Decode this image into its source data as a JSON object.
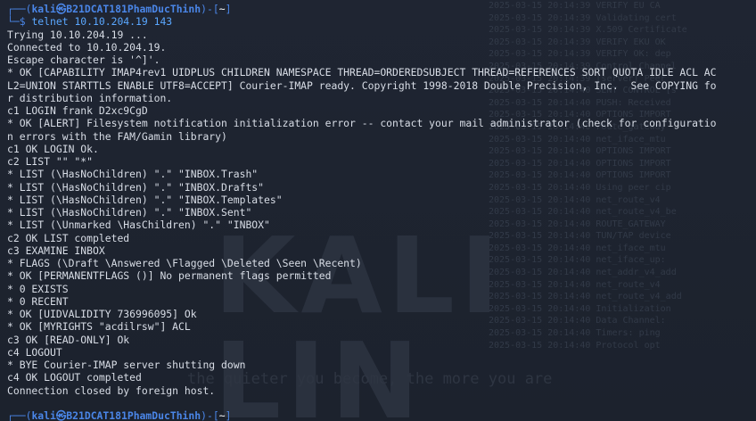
{
  "prompt": {
    "open": "┌──(",
    "user": "kali㉿B21DCAT181PhamDucThinh",
    "close": ")-[",
    "path": "~",
    "end": "]",
    "arrow": "└─$",
    "command": "telnet 10.10.204.19 143"
  },
  "output_lines": [
    "Trying 10.10.204.19 ...",
    "Connected to 10.10.204.19.",
    "Escape character is '^]'.",
    "* OK [CAPABILITY IMAP4rev1 UIDPLUS CHILDREN NAMESPACE THREAD=ORDEREDSUBJECT THREAD=REFERENCES SORT QUOTA IDLE ACL AC",
    "L2=UNION STARTTLS ENABLE UTF8=ACCEPT] Courier-IMAP ready. Copyright 1998-2018 Double Precision, Inc.  See COPYING fo",
    "r distribution information.",
    "c1 LOGIN frank D2xc9CgD",
    "* OK [ALERT] Filesystem notification initialization error -- contact your mail administrator (check for configuratio",
    "n errors with the FAM/Gamin library)",
    "c1 OK LOGIN Ok.",
    "c2 LIST \"\" \"*\"",
    "* LIST (\\HasNoChildren) \".\" \"INBOX.Trash\"",
    "* LIST (\\HasNoChildren) \".\" \"INBOX.Drafts\"",
    "* LIST (\\HasNoChildren) \".\" \"INBOX.Templates\"",
    "* LIST (\\HasNoChildren) \".\" \"INBOX.Sent\"",
    "* LIST (\\Unmarked \\HasChildren) \".\" \"INBOX\"",
    "c2 OK LIST completed",
    "c3 EXAMINE INBOX",
    "* FLAGS (\\Draft \\Answered \\Flagged \\Deleted \\Seen \\Recent)",
    "* OK [PERMANENTFLAGS ()] No permanent flags permitted",
    "* 0 EXISTS",
    "* 0 RECENT",
    "* OK [UIDVALIDITY 736996095] Ok",
    "* OK [MYRIGHTS \"acdilrsw\"] ACL",
    "c3 OK [READ-ONLY] Ok",
    "c4 LOGOUT",
    "* BYE Courier-IMAP server shutting down",
    "c4 OK LOGOUT completed",
    "Connection closed by foreign host."
  ],
  "watermark": "KALI LIN",
  "tagline": "the quieter you become, the more you are",
  "background_log": "2025-03-15 20:14:39 VERIFY EU CA\n2025-03-15 20:14:39 Validating cert\n2025-03-15 20:14:39 X.509 Certificate\n2025-03-15 20:14:39 VERIFY EKU OK\n2025-03-15 20:14:39 VERIFY OK: dep\n2025-03-15 20:14:39 Control Channel\n2025-03-15 20:14:39 [server] Peer\n2025-03-15 20:14:40 SENT CONTROL [s\n2025-03-15 20:14:40 PUSH: Received\n2025-03-15 20:14:40 OPTIONS IMPORT\n2025-03-15 20:14:40 route_gateway\n2025-03-15 20:14:40 net_iface_mtu\n2025-03-15 20:14:40 OPTIONS IMPORT\n2025-03-15 20:14:40 OPTIONS IMPORT\n2025-03-15 20:14:40 OPTIONS IMPORT\n2025-03-15 20:14:40 Using peer cip\n2025-03-15 20:14:40 net_route_v4\n2025-03-15 20:14:40 net_route_v4_be\n2025-03-15 20:14:40 ROUTE_GATEWAY\n2025-03-15 20:14:40 TUN/TAP device\n2025-03-15 20:14:40 net_iface_mtu\n2025-03-15 20:14:40 net_iface_up:\n2025-03-15 20:14:40 net_addr_v4_add\n2025-03-15 20:14:40 net_route_v4\n2025-03-15 20:14:40 net_route_v4_add\n2025-03-15 20:14:40 Initialization\n2025-03-15 20:14:40 Data Channel:\n2025-03-15 20:14:40 Timers: ping\n2025-03-15 20:14:40 Protocol opt"
}
